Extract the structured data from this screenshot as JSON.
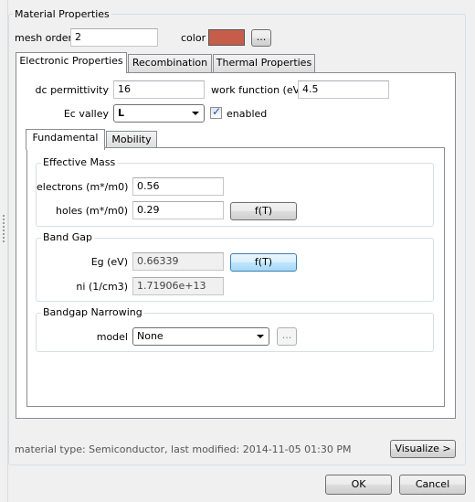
{
  "material_properties": {
    "title": "Material Properties",
    "mesh_order_label": "mesh order",
    "mesh_order_value": "2",
    "color_label": "color",
    "color_swatch": "#c65d4a",
    "color_button": "...",
    "tabs": [
      {
        "label": "Electronic Properties",
        "active": true
      },
      {
        "label": "Recombination",
        "active": false
      },
      {
        "label": "Thermal Properties",
        "active": false
      }
    ]
  },
  "electronic": {
    "dc_permittivity_label": "dc permittivity",
    "dc_permittivity_value": "16",
    "work_function_label": "work function (eV)",
    "work_function_value": "4.5",
    "ec_valley_label": "Ec valley",
    "ec_valley_value": "L",
    "enabled_label": "enabled",
    "enabled_checked": true,
    "subtabs": [
      {
        "label": "Fundamental",
        "active": true
      },
      {
        "label": "Mobility",
        "active": false
      }
    ]
  },
  "effective_mass": {
    "title": "Effective Mass",
    "electrons_label": "electrons (m*/m0)",
    "electrons_value": "0.56",
    "holes_label": "holes (m*/m0)",
    "holes_value": "0.29",
    "ft_button": "f(T)"
  },
  "band_gap": {
    "title": "Band Gap",
    "eg_label": "Eg (eV)",
    "eg_value": "0.66339",
    "ft_button": "f(T)",
    "ni_label": "ni (1/cm3)",
    "ni_value": "1.71906e+13"
  },
  "bandgap_narrowing": {
    "title": "Bandgap Narrowing",
    "model_label": "model",
    "model_value": "None",
    "more_button": "..."
  },
  "footer": {
    "status": "material type: Semiconductor, last modified: 2014-11-05 01:30 PM",
    "visualize_button": "Visualize >",
    "ok_button": "OK",
    "cancel_button": "Cancel"
  }
}
